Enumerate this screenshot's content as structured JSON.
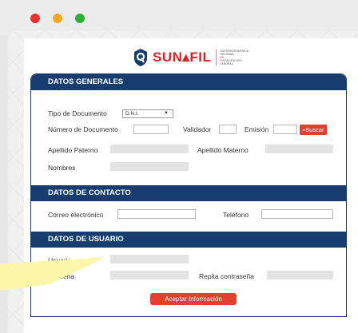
{
  "logo": {
    "text": "SUN▴FIL",
    "subtitle": "SUPERINTENDENCIA NACIONAL DE FISCALIZACIÓN LABORAL"
  },
  "sections": {
    "general": "DATOS GENERALES",
    "contact": "DATOS DE CONTACTO",
    "user": "DATOS DE USUARIO"
  },
  "fields": {
    "tipo_documento_label": "Tipo de Documento",
    "tipo_documento_value": "D.N.I.",
    "numero_documento_label": "Número de Documento",
    "validador_label": "Validador",
    "emision_label": "Emisión",
    "buscar_label": "Buscar",
    "apellido_paterno_label": "Apellido Paterno",
    "apellido_materno_label": "Apellido Materno",
    "nombres_label": "Nombres",
    "correo_label": "Correo electrónico",
    "telefono_label": "Teléfono",
    "usuario_label": "Usuario",
    "contrasena_label": "ntraseña",
    "repita_label": "Repita contraseña"
  },
  "actions": {
    "aceptar": "Aceptar Información"
  },
  "colors": {
    "header_navy": "#173d6e",
    "accent_red": "#e2402f",
    "tooltip_yellow": "#fbf6a8"
  }
}
